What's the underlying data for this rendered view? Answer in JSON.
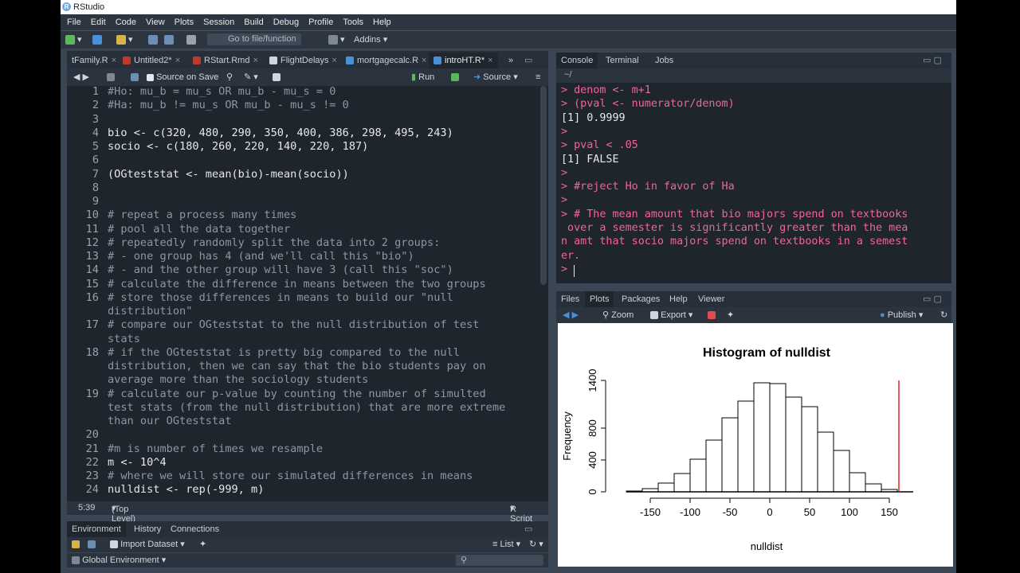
{
  "window": {
    "title": "RStudio"
  },
  "menu": [
    "File",
    "Edit",
    "Code",
    "View",
    "Plots",
    "Session",
    "Build",
    "Debug",
    "Profile",
    "Tools",
    "Help"
  ],
  "toolbar": {
    "goto_placeholder": "Go to file/function",
    "addins": "Addins"
  },
  "editor": {
    "tabs": [
      {
        "label": "tFamily.R",
        "active": false
      },
      {
        "label": "Untitled2*",
        "active": false
      },
      {
        "label": "RStart.Rmd",
        "active": false
      },
      {
        "label": "FlightDelays",
        "active": false
      },
      {
        "label": "mortgagecalc.R",
        "active": false
      },
      {
        "label": "introHT.R*",
        "active": true
      }
    ],
    "toolbar": {
      "source_on_save": "Source on Save",
      "run": "Run",
      "source": "Source"
    },
    "lines": [
      {
        "n": "1",
        "text": "#Ho: mu_b = mu_s OR mu_b - mu_s = 0"
      },
      {
        "n": "2",
        "text": "#Ha: mu_b != mu_s OR mu_b - mu_s != 0"
      },
      {
        "n": "3",
        "text": ""
      },
      {
        "n": "4",
        "text": "bio <- c(320, 480, 290, 350, 400, 386, 298, 495, 243)"
      },
      {
        "n": "5",
        "text": "socio <- c(180, 260, 220, 140, 220, 187)"
      },
      {
        "n": "6",
        "text": ""
      },
      {
        "n": "7",
        "text": "(OGteststat <- mean(bio)-mean(socio))"
      },
      {
        "n": "8",
        "text": ""
      },
      {
        "n": "9",
        "text": ""
      },
      {
        "n": "10",
        "text": "# repeat a process many times"
      },
      {
        "n": "11",
        "text": "# pool all the data together"
      },
      {
        "n": "12",
        "text": "# repeatedly randomly split the data into 2 groups:"
      },
      {
        "n": "13",
        "text": "# - one group has 4 (and we'll call this \"bio\")"
      },
      {
        "n": "14",
        "text": "# - and the other group will have 3 (call this \"soc\")"
      },
      {
        "n": "15",
        "text": "# calculate the difference in means between the two groups"
      },
      {
        "n": "16",
        "text": "# store those differences in means to build our \"null"
      },
      {
        "n": "",
        "text": "distribution\""
      },
      {
        "n": "17",
        "text": "# compare our OGteststat to the null distribution of test"
      },
      {
        "n": "",
        "text": "stats"
      },
      {
        "n": "18",
        "text": "# if the OGteststat is pretty big compared to the null"
      },
      {
        "n": "",
        "text": "distribution, then we can say that the bio students pay on"
      },
      {
        "n": "",
        "text": "average more than the sociology students"
      },
      {
        "n": "19",
        "text": "# calculate our p-value by counting the number of simulted"
      },
      {
        "n": "",
        "text": "test stats (from the null distribution) that are more extreme"
      },
      {
        "n": "",
        "text": "than our OGteststat"
      },
      {
        "n": "20",
        "text": ""
      },
      {
        "n": "21",
        "text": "#m is number of times we resample"
      },
      {
        "n": "22",
        "text": "m <- 10^4"
      },
      {
        "n": "23",
        "text": "# where we will store our simulated differences in means"
      },
      {
        "n": "24",
        "text": "nulldist <- rep(-999, m)"
      }
    ],
    "status": {
      "position": "5:39",
      "scope": "(Top Level)",
      "filetype": "R Script"
    }
  },
  "environment": {
    "tabs": [
      "Environment",
      "History",
      "Connections"
    ],
    "import_dataset": "Import Dataset",
    "list_label": "List",
    "global_env": "Global Environment"
  },
  "console": {
    "tabs": [
      "Console",
      "Terminal",
      "Jobs"
    ],
    "path": "~/",
    "lines": [
      {
        "type": "prompt",
        "text": "> denom <- m+1"
      },
      {
        "type": "prompt",
        "text": "> (pval <- numerator/denom)"
      },
      {
        "type": "output",
        "text": "[1] 0.9999"
      },
      {
        "type": "prompt",
        "text": ">"
      },
      {
        "type": "prompt",
        "text": "> pval < .05"
      },
      {
        "type": "output",
        "text": "[1] FALSE"
      },
      {
        "type": "prompt",
        "text": ">"
      },
      {
        "type": "prompt",
        "text": "> #reject Ho in favor of Ha"
      },
      {
        "type": "prompt",
        "text": ">"
      },
      {
        "type": "prompt",
        "text": "> # The mean amount that bio majors spend on textbooks"
      },
      {
        "type": "prompt",
        "text": " over a semester is significantly greater than the mea"
      },
      {
        "type": "prompt",
        "text": "n amt that socio majors spend on textbooks in a semest"
      },
      {
        "type": "prompt",
        "text": "er."
      },
      {
        "type": "prompt",
        "text": "> "
      }
    ]
  },
  "files": {
    "tabs": [
      "Files",
      "Plots",
      "Packages",
      "Help",
      "Viewer"
    ],
    "zoom": "Zoom",
    "export": "Export",
    "publish": "Publish"
  },
  "chart_data": {
    "type": "bar",
    "title": "Histogram of nulldist",
    "xlabel": "nulldist",
    "ylabel": "Frequency",
    "xlim": [
      -180,
      180
    ],
    "ylim": [
      0,
      1400
    ],
    "x_ticks": [
      "-150",
      "-100",
      "-50",
      "0",
      "50",
      "100",
      "150"
    ],
    "y_ticks": [
      "0",
      "400",
      "800",
      "1400"
    ],
    "bin_edges": [
      -180,
      -160,
      -140,
      -120,
      -100,
      -80,
      -60,
      -40,
      -20,
      0,
      20,
      40,
      60,
      80,
      100,
      120,
      140,
      160
    ],
    "values": [
      10,
      40,
      110,
      230,
      410,
      650,
      930,
      1140,
      1370,
      1360,
      1190,
      1070,
      750,
      520,
      240,
      100,
      30
    ],
    "observed_line_x": 162,
    "observed_line_color": "#e02020"
  },
  "colors": {
    "accent_prompt": "#f0659c",
    "number": "#f6a447",
    "comment": "#8c96a6"
  }
}
